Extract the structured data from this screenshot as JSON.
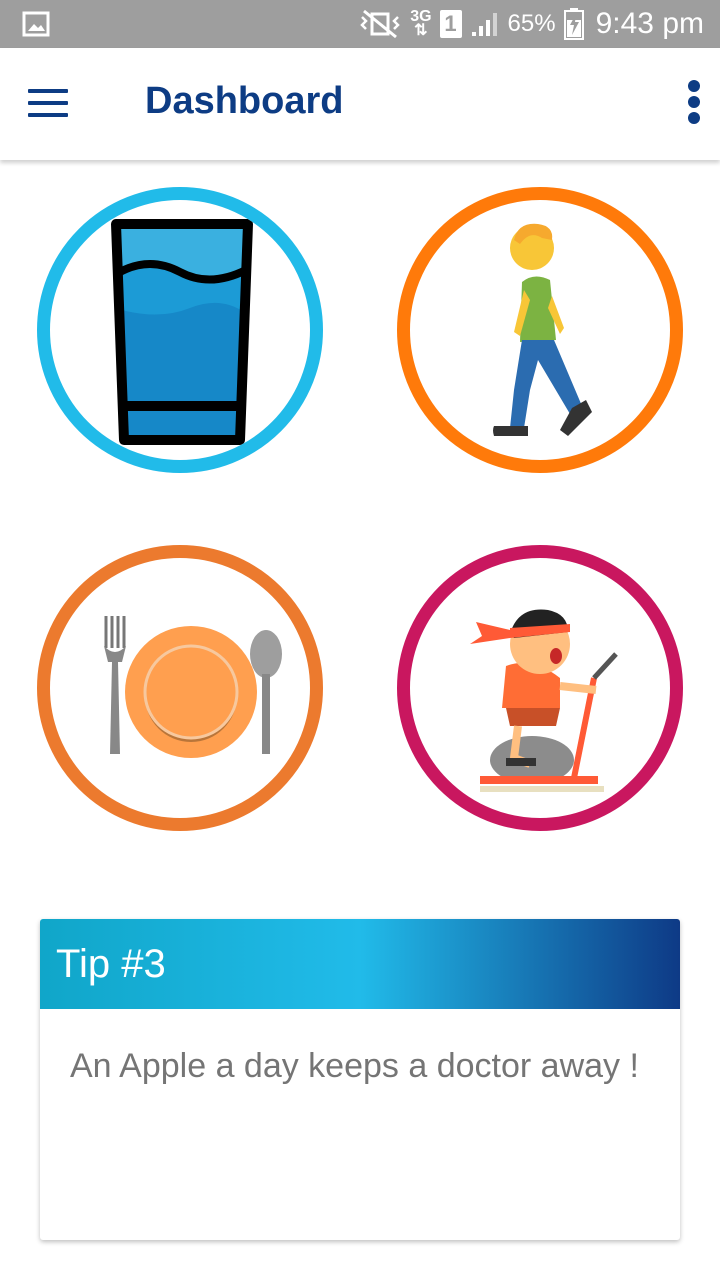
{
  "status_bar": {
    "battery": "65%",
    "time": "9:43 pm",
    "network": "3G",
    "sim": "1",
    "icons": [
      "gallery-icon",
      "mute-vibrate-icon",
      "network-3g-icon",
      "sim-icon",
      "signal-icon",
      "battery-charging-icon"
    ]
  },
  "app_bar": {
    "title": "Dashboard",
    "menu_icon": "hamburger-icon",
    "overflow_icon": "overflow-menu-icon"
  },
  "tiles": [
    {
      "name": "water",
      "icon": "water-glass-icon",
      "ring_color": "#21bbe9"
    },
    {
      "name": "walking",
      "icon": "walking-person-icon",
      "ring_color": "#ff7a0a"
    },
    {
      "name": "meal",
      "icon": "plate-cutlery-icon",
      "ring_color": "#ec7a2e"
    },
    {
      "name": "exercise",
      "icon": "elliptical-trainer-icon",
      "ring_color": "#c9175f"
    }
  ],
  "tip": {
    "title": "Tip #3",
    "text": "An Apple a day keeps a doctor away !"
  },
  "colors": {
    "primary": "#0d3c84",
    "accent": "#21bbe9",
    "status_bar": "#9e9e9e"
  }
}
